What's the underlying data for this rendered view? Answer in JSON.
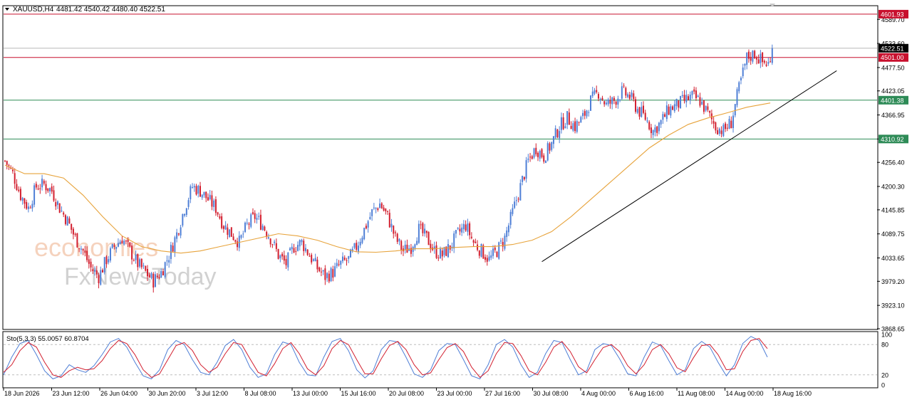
{
  "header": {
    "symbol": "XAUUSD,H4",
    "ohlc": "4481.42 4540.42 4480.40 4522.51",
    "menu_icon": "triangle-down-icon"
  },
  "watermark": {
    "line1": "economies",
    "line2": "FxNewsToday"
  },
  "colors": {
    "bull": "#4f7fd6",
    "bear": "#d21f2f",
    "ma": "#e7a33b",
    "trendline": "#000000",
    "resistance": "#c8102e",
    "support": "#2e8b57",
    "stoch_main": "#4f7fd6",
    "stoch_signal": "#d21f2f",
    "price_tag_current": "#000000"
  },
  "chart_data": [
    {
      "type": "candlestick",
      "title": "XAUUSD,H4",
      "ylim": [
        3868.65,
        4620.0
      ],
      "y_ticks": [
        "4589.70",
        "4533.60",
        "4477.50",
        "4423.05",
        "4366.95",
        "4310.92",
        "4256.40",
        "4200.30",
        "4145.85",
        "4089.75",
        "4033.65",
        "3979.20",
        "3923.10",
        "3868.65"
      ],
      "x_ticks": [
        "18 Jun 2026",
        "23 Jun 12:00",
        "26 Jun 04:00",
        "30 Jun 20:00",
        "3 Jul 12:00",
        "8 Jul 08:00",
        "13 Jul 00:00",
        "15 Jul 16:00",
        "20 Jul 08:00",
        "23 Jul 00:00",
        "27 Jul 16:00",
        "30 Jul 08:00",
        "4 Aug 00:00",
        "6 Aug 16:00",
        "11 Aug 08:00",
        "14 Aug 00:00",
        "18 Aug 16:00"
      ],
      "horizontal_levels": [
        {
          "value": 4601.93,
          "label": "4601.93",
          "kind": "resistance"
        },
        {
          "value": 4501.0,
          "label": "4501.00",
          "kind": "resistance"
        },
        {
          "value": 4401.38,
          "label": "4401.38",
          "kind": "support"
        },
        {
          "value": 4310.92,
          "label": "4310.92",
          "kind": "support"
        }
      ],
      "current_price": {
        "value": 4522.51,
        "label": "4522.51"
      },
      "close_path": [
        [
          0,
          4260
        ],
        [
          4,
          4230
        ],
        [
          8,
          4180
        ],
        [
          12,
          4150
        ],
        [
          16,
          4200
        ],
        [
          20,
          4205
        ],
        [
          24,
          4190
        ],
        [
          28,
          4150
        ],
        [
          32,
          4120
        ],
        [
          36,
          4080
        ],
        [
          40,
          4050
        ],
        [
          44,
          4010
        ],
        [
          48,
          3990
        ],
        [
          52,
          4030
        ],
        [
          56,
          4060
        ],
        [
          60,
          4080
        ],
        [
          64,
          4050
        ],
        [
          68,
          4020
        ],
        [
          72,
          4000
        ],
        [
          76,
          3980
        ],
        [
          80,
          4000
        ],
        [
          84,
          4040
        ],
        [
          88,
          4090
        ],
        [
          92,
          4150
        ],
        [
          96,
          4200
        ],
        [
          100,
          4190
        ],
        [
          104,
          4170
        ],
        [
          108,
          4150
        ],
        [
          112,
          4110
        ],
        [
          116,
          4090
        ],
        [
          120,
          4070
        ],
        [
          124,
          4110
        ],
        [
          128,
          4130
        ],
        [
          132,
          4110
        ],
        [
          136,
          4080
        ],
        [
          140,
          4040
        ],
        [
          144,
          4020
        ],
        [
          148,
          4060
        ],
        [
          152,
          4070
        ],
        [
          156,
          4040
        ],
        [
          160,
          4010
        ],
        [
          164,
          3990
        ],
        [
          168,
          4000
        ],
        [
          172,
          4020
        ],
        [
          176,
          4030
        ],
        [
          180,
          4060
        ],
        [
          184,
          4100
        ],
        [
          188,
          4140
        ],
        [
          192,
          4160
        ],
        [
          196,
          4130
        ],
        [
          200,
          4080
        ],
        [
          204,
          4050
        ],
        [
          208,
          4060
        ],
        [
          212,
          4100
        ],
        [
          216,
          4080
        ],
        [
          220,
          4050
        ],
        [
          224,
          4040
        ],
        [
          228,
          4060
        ],
        [
          232,
          4090
        ],
        [
          236,
          4110
        ],
        [
          240,
          4070
        ],
        [
          244,
          4050
        ],
        [
          248,
          4030
        ],
        [
          252,
          4050
        ],
        [
          256,
          4080
        ],
        [
          260,
          4140
        ],
        [
          264,
          4200
        ],
        [
          268,
          4260
        ],
        [
          272,
          4290
        ],
        [
          276,
          4270
        ],
        [
          280,
          4300
        ],
        [
          284,
          4340
        ],
        [
          288,
          4360
        ],
        [
          292,
          4340
        ],
        [
          296,
          4360
        ],
        [
          300,
          4400
        ],
        [
          304,
          4420
        ],
        [
          308,
          4390
        ],
        [
          312,
          4400
        ],
        [
          316,
          4420
        ],
        [
          320,
          4410
        ],
        [
          324,
          4380
        ],
        [
          328,
          4360
        ],
        [
          332,
          4330
        ],
        [
          336,
          4350
        ],
        [
          340,
          4380
        ],
        [
          344,
          4390
        ],
        [
          348,
          4400
        ],
        [
          352,
          4410
        ],
        [
          356,
          4400
        ],
        [
          360,
          4370
        ],
        [
          364,
          4340
        ],
        [
          368,
          4330
        ],
        [
          372,
          4350
        ],
        [
          376,
          4430
        ],
        [
          380,
          4500
        ],
        [
          384,
          4510
        ],
        [
          388,
          4490
        ],
        [
          392,
          4485
        ],
        [
          393,
          4522.51
        ]
      ],
      "moving_average": [
        [
          0,
          4250
        ],
        [
          10,
          4230
        ],
        [
          20,
          4230
        ],
        [
          30,
          4220
        ],
        [
          40,
          4180
        ],
        [
          50,
          4130
        ],
        [
          60,
          4085
        ],
        [
          70,
          4060
        ],
        [
          80,
          4050
        ],
        [
          90,
          4045
        ],
        [
          100,
          4050
        ],
        [
          110,
          4060
        ],
        [
          120,
          4070
        ],
        [
          130,
          4080
        ],
        [
          140,
          4090
        ],
        [
          150,
          4085
        ],
        [
          160,
          4075
        ],
        [
          170,
          4060
        ],
        [
          180,
          4048
        ],
        [
          190,
          4047
        ],
        [
          200,
          4050
        ],
        [
          210,
          4055
        ],
        [
          220,
          4055
        ],
        [
          230,
          4058
        ],
        [
          240,
          4060
        ],
        [
          250,
          4060
        ],
        [
          260,
          4065
        ],
        [
          270,
          4075
        ],
        [
          280,
          4095
        ],
        [
          290,
          4130
        ],
        [
          300,
          4170
        ],
        [
          310,
          4210
        ],
        [
          320,
          4250
        ],
        [
          330,
          4290
        ],
        [
          340,
          4320
        ],
        [
          350,
          4345
        ],
        [
          360,
          4360
        ],
        [
          370,
          4372
        ],
        [
          380,
          4385
        ],
        [
          392,
          4395
        ]
      ],
      "trendline": {
        "from": [
          275,
          4025
        ],
        "to": [
          426,
          4470
        ]
      }
    },
    {
      "type": "line",
      "title": "Sto(5,3,3) 55.0057 60.8704",
      "ylim": [
        0,
        100
      ],
      "levels": [
        20,
        80
      ],
      "y_ticks": [
        "100",
        "80",
        "20",
        "0"
      ],
      "series": [
        {
          "name": "main",
          "values": [
            20,
            55,
            82,
            88,
            60,
            28,
            12,
            18,
            40,
            30,
            25,
            38,
            60,
            85,
            92,
            75,
            45,
            18,
            12,
            30,
            70,
            88,
            80,
            50,
            25,
            20,
            45,
            78,
            90,
            70,
            35,
            15,
            22,
            60,
            85,
            80,
            45,
            20,
            18,
            55,
            86,
            92,
            68,
            30,
            14,
            28,
            70,
            88,
            85,
            55,
            22,
            15,
            30,
            68,
            82,
            80,
            50,
            18,
            12,
            40,
            80,
            90,
            75,
            40,
            15,
            25,
            62,
            88,
            84,
            50,
            20,
            28,
            70,
            82,
            78,
            52,
            22,
            18,
            55,
            85,
            78,
            48,
            20,
            30,
            72,
            86,
            75,
            45,
            18,
            40,
            82,
            96,
            88,
            55
          ]
        },
        {
          "name": "signal",
          "values": [
            25,
            40,
            68,
            84,
            75,
            45,
            20,
            15,
            28,
            35,
            30,
            32,
            48,
            72,
            88,
            82,
            60,
            30,
            15,
            22,
            50,
            78,
            84,
            68,
            40,
            25,
            35,
            62,
            84,
            80,
            52,
            25,
            18,
            42,
            72,
            84,
            62,
            32,
            20,
            38,
            72,
            88,
            80,
            50,
            22,
            22,
            52,
            78,
            86,
            70,
            40,
            20,
            24,
            50,
            74,
            82,
            66,
            35,
            15,
            28,
            62,
            84,
            82,
            58,
            28,
            20,
            45,
            75,
            86,
            66,
            36,
            24,
            50,
            74,
            80,
            66,
            38,
            22,
            40,
            70,
            80,
            62,
            34,
            26,
            54,
            78,
            80,
            60,
            30,
            32,
            66,
            88,
            92,
            72
          ]
        }
      ]
    }
  ]
}
